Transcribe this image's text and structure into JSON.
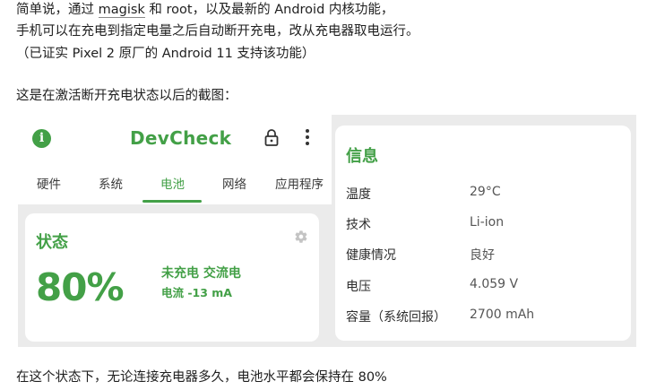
{
  "article": {
    "line1_before": "简单说，通过 ",
    "line1_link": "magisk",
    "line1_after": " 和 root，以及最新的 Android 内核功能，",
    "line2": "手机可以在充电到指定电量之后自动断开充电，改从充电器取电运行。",
    "line3": "（已证实 Pixel 2 原厂的 Android 11 支持该功能）",
    "line4": "这是在激活断开充电状态以后的截图：",
    "line5": "在这个状态下，无论连接充电器多久，电池水平都会保持在 80%"
  },
  "app": {
    "title": "DevCheck",
    "tabs": [
      "硬件",
      "系统",
      "电池",
      "网络",
      "应用程序"
    ],
    "active_tab": "电池",
    "status_card": {
      "title": "状态",
      "percent": "80%",
      "state": "未充电 交流电",
      "current": "电流 -13 mA"
    },
    "info_card": {
      "title": "信息",
      "rows": [
        {
          "label": "温度",
          "value": "29°C"
        },
        {
          "label": "技术",
          "value": "Li-ion"
        },
        {
          "label": "健康情况",
          "value": "良好"
        },
        {
          "label": "电压",
          "value": "4.059 V"
        },
        {
          "label": "容量（系统回报）",
          "value": "2700 mAh"
        }
      ]
    },
    "accent_color": "#43a047"
  }
}
